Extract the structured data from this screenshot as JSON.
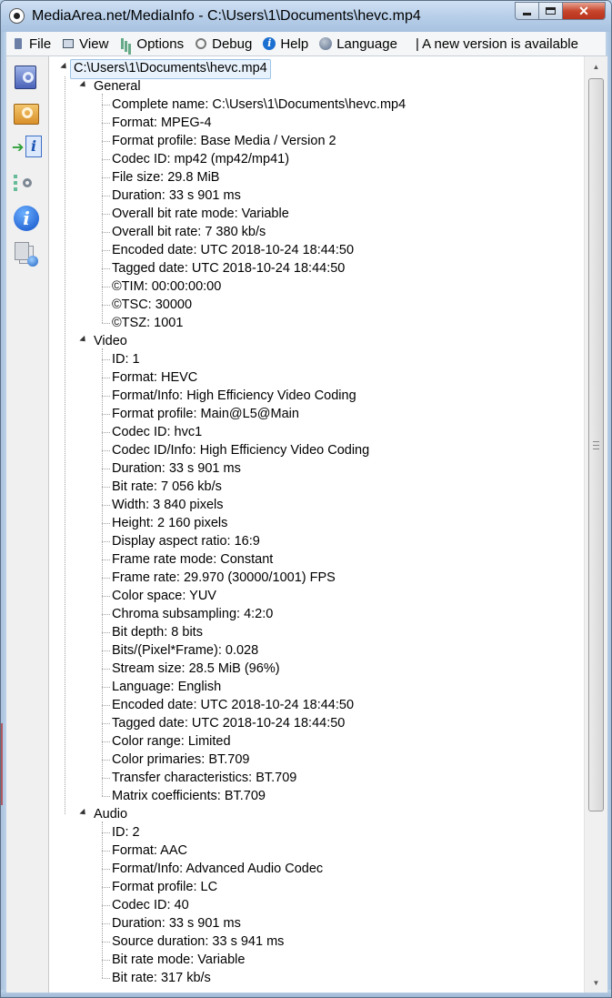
{
  "window": {
    "title": "MediaArea.net/MediaInfo - C:\\Users\\1\\Documents\\hevc.mp4"
  },
  "menu": {
    "file": "File",
    "view": "View",
    "options": "Options",
    "debug": "Debug",
    "help": "Help",
    "language": "Language",
    "new_version": "| A new version is available"
  },
  "toolbar": {
    "icons": [
      "open-file-icon",
      "open-folder-icon",
      "export-icon",
      "preferences-icon",
      "about-icon",
      "knowledge-base-icon"
    ]
  },
  "tree": {
    "root": "C:\\Users\\1\\Documents\\hevc.mp4",
    "sections": [
      {
        "name": "General",
        "items": [
          "Complete name: C:\\Users\\1\\Documents\\hevc.mp4",
          "Format: MPEG-4",
          "Format profile: Base Media / Version 2",
          "Codec ID: mp42 (mp42/mp41)",
          "File size: 29.8 MiB",
          "Duration: 33 s 901 ms",
          "Overall bit rate mode: Variable",
          "Overall bit rate: 7 380 kb/s",
          "Encoded date: UTC 2018-10-24 18:44:50",
          "Tagged date: UTC 2018-10-24 18:44:50",
          "©TIM: 00:00:00:00",
          "©TSC: 30000",
          "©TSZ: 1001"
        ]
      },
      {
        "name": "Video",
        "items": [
          "ID: 1",
          "Format: HEVC",
          "Format/Info: High Efficiency Video Coding",
          "Format profile: Main@L5@Main",
          "Codec ID: hvc1",
          "Codec ID/Info: High Efficiency Video Coding",
          "Duration: 33 s 901 ms",
          "Bit rate: 7 056 kb/s",
          "Width: 3 840 pixels",
          "Height: 2 160 pixels",
          "Display aspect ratio: 16:9",
          "Frame rate mode: Constant",
          "Frame rate: 29.970 (30000/1001) FPS",
          "Color space: YUV",
          "Chroma subsampling: 4:2:0",
          "Bit depth: 8 bits",
          "Bits/(Pixel*Frame): 0.028",
          "Stream size: 28.5 MiB (96%)",
          "Language: English",
          "Encoded date: UTC 2018-10-24 18:44:50",
          "Tagged date: UTC 2018-10-24 18:44:50",
          "Color range: Limited",
          "Color primaries: BT.709",
          "Transfer characteristics: BT.709",
          "Matrix coefficients: BT.709"
        ]
      },
      {
        "name": "Audio",
        "items": [
          "ID: 2",
          "Format: AAC",
          "Format/Info: Advanced Audio Codec",
          "Format profile: LC",
          "Codec ID: 40",
          "Duration: 33 s 901 ms",
          "Source duration: 33 s 941 ms",
          "Bit rate mode: Variable",
          "Bit rate: 317 kb/s"
        ]
      }
    ]
  },
  "scrollbar": {
    "position": 0.0,
    "visible_fraction": 0.82
  }
}
